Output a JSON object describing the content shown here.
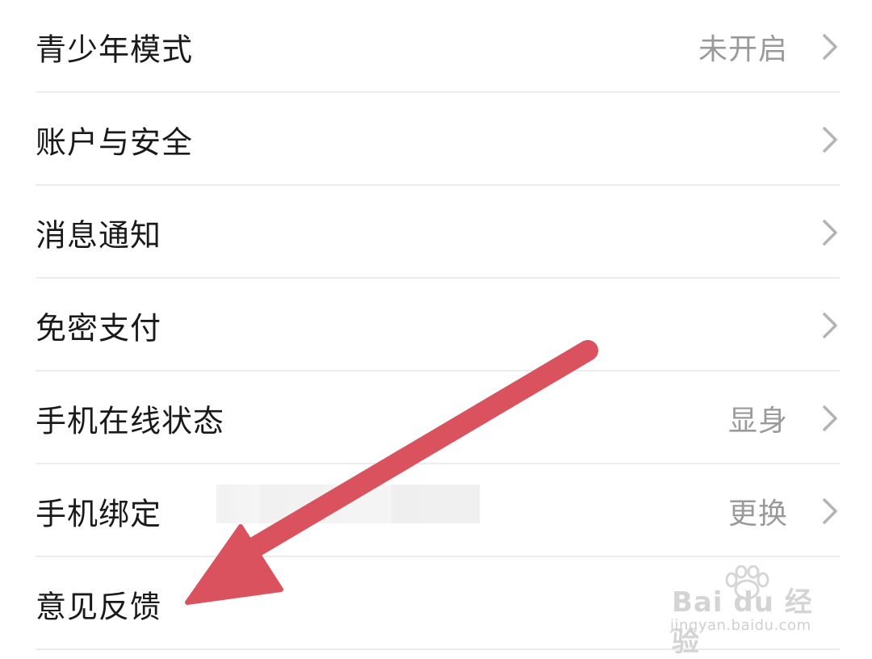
{
  "settings": {
    "items": [
      {
        "label": "青少年模式",
        "value": "未开启"
      },
      {
        "label": "账户与安全",
        "value": ""
      },
      {
        "label": "消息通知",
        "value": ""
      },
      {
        "label": "免密支付",
        "value": ""
      },
      {
        "label": "手机在线状态",
        "value": "显身"
      },
      {
        "label": "手机绑定",
        "value": "更换"
      },
      {
        "label": "意见反馈",
        "value": ""
      }
    ]
  },
  "annotation": {
    "arrow_color": "#d9525e",
    "points_to": "意见反馈"
  },
  "watermark": {
    "logo_text": "Bai du 经验",
    "url": "jingyan.baidu.com"
  },
  "colors": {
    "label": "#1a1a1a",
    "value": "#9a9a9a",
    "chevron": "#b3b3b3",
    "divider": "#ececec"
  }
}
